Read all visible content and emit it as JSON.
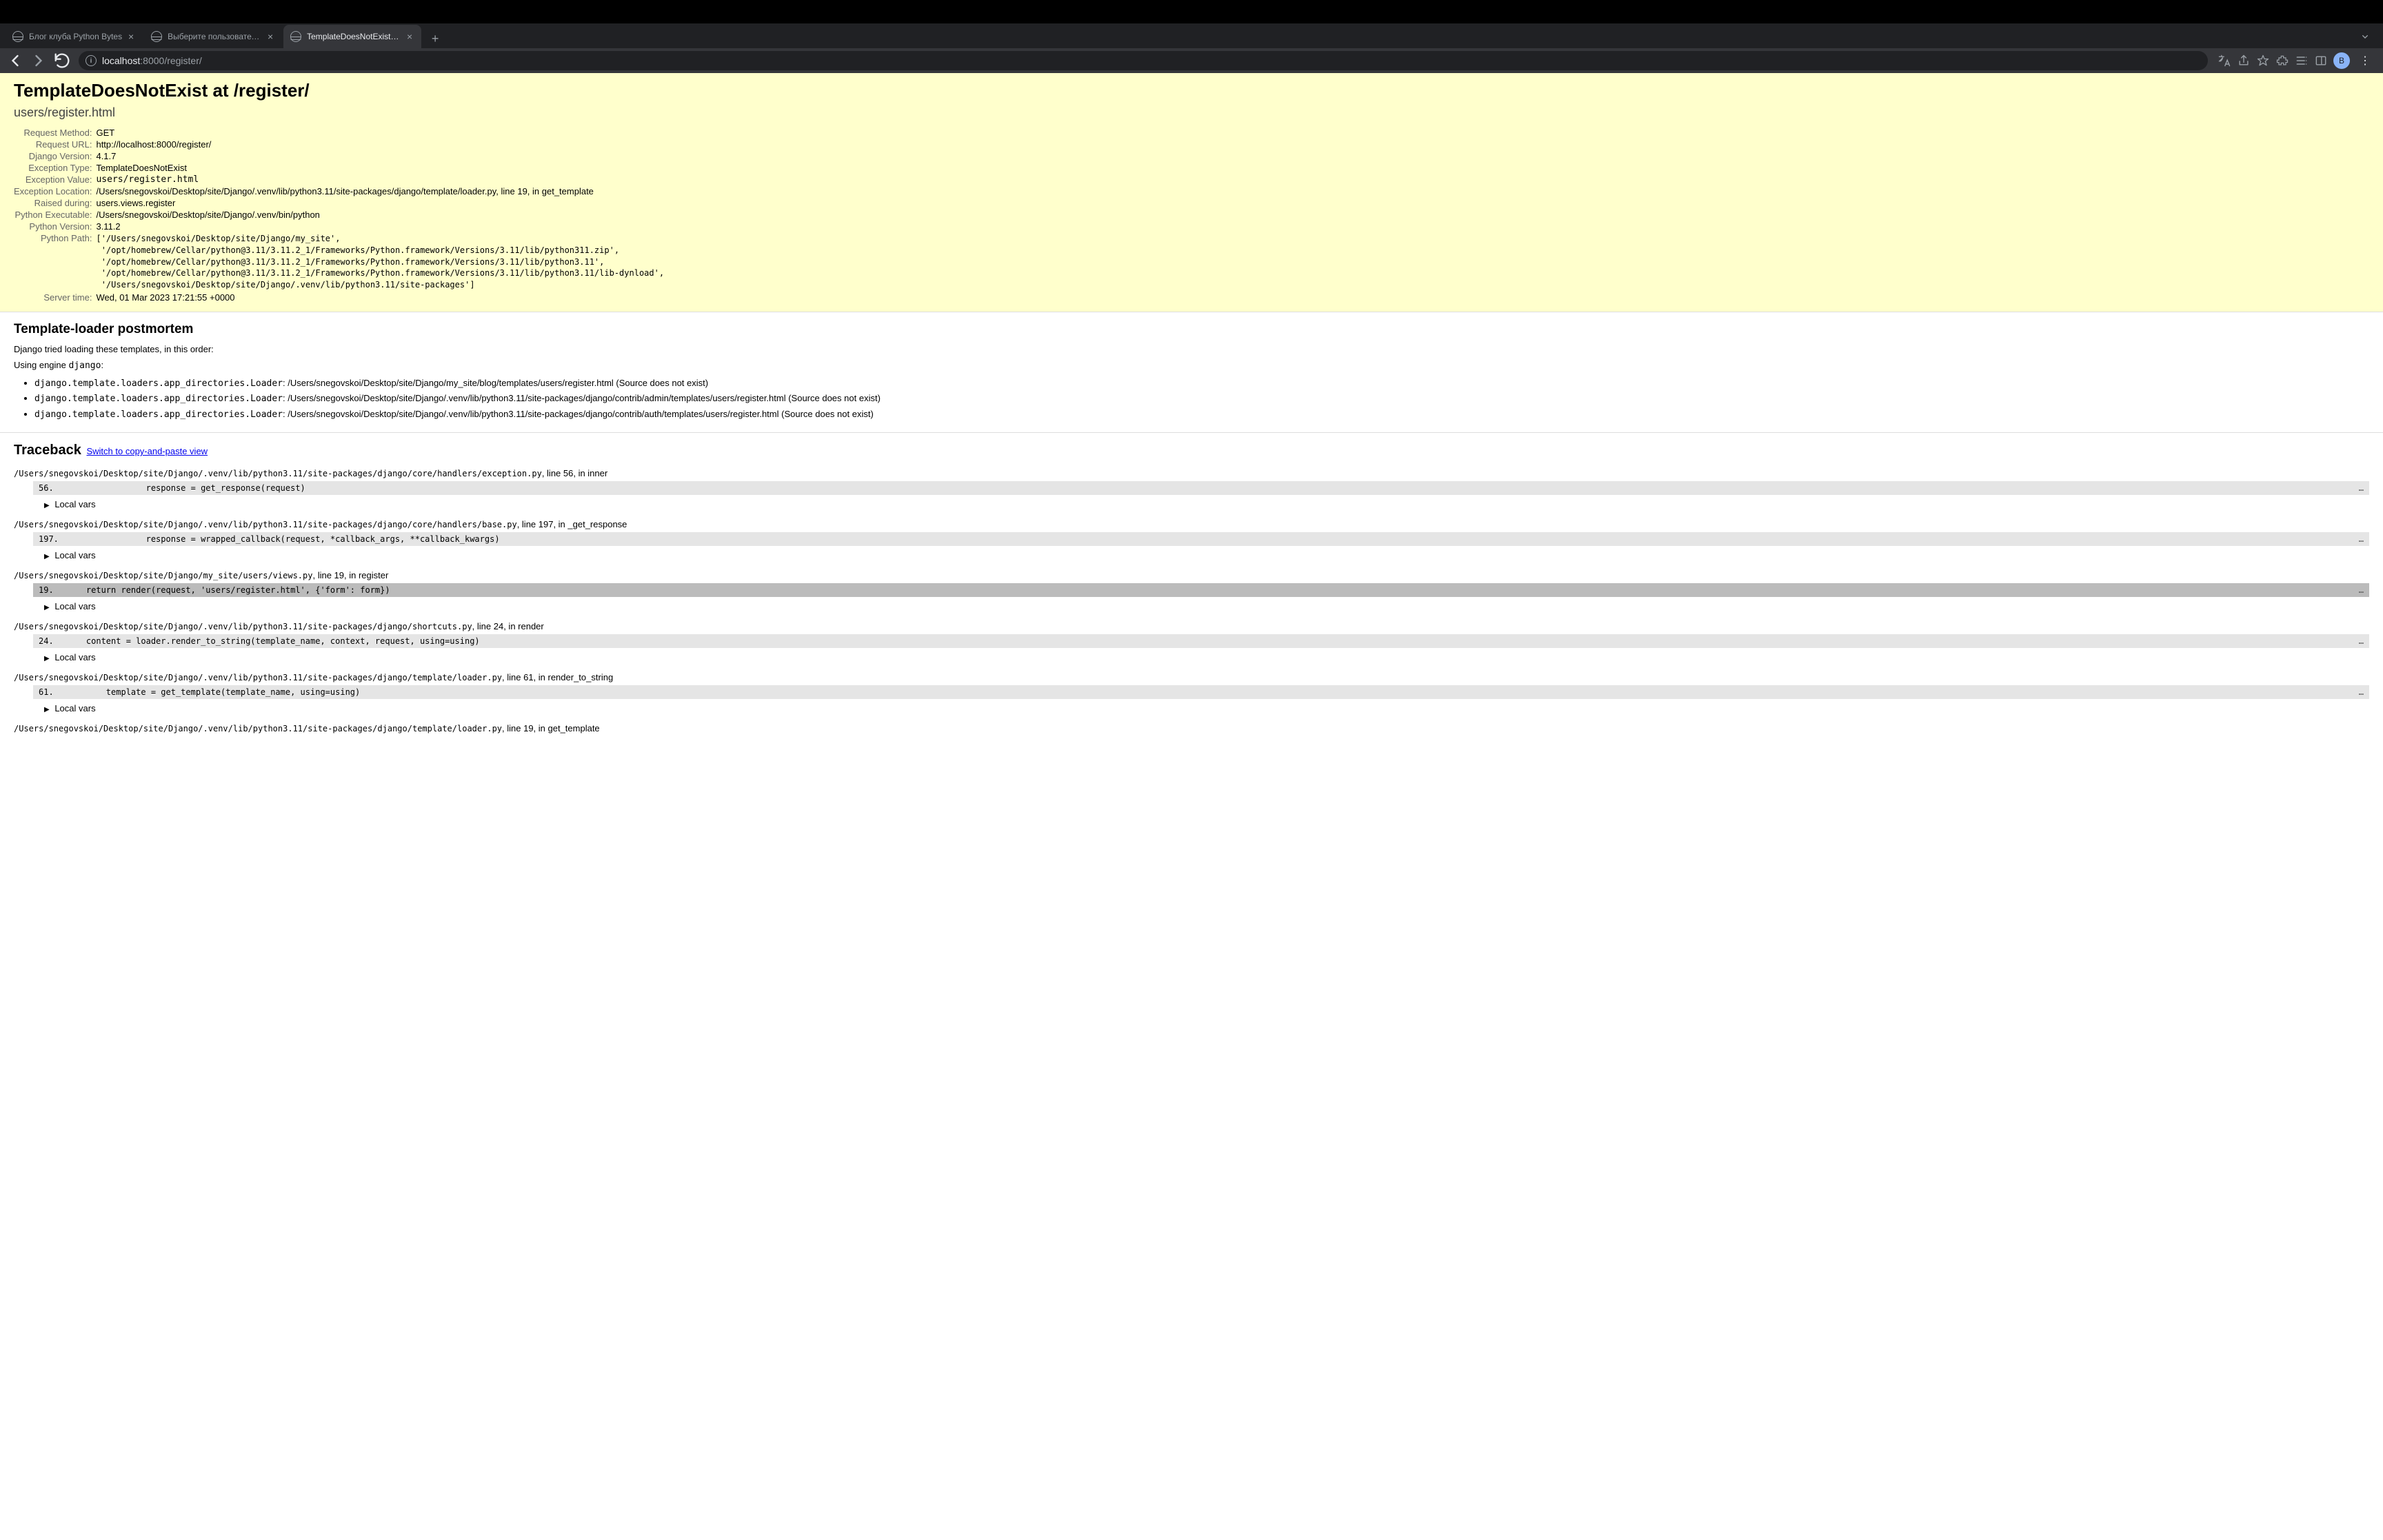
{
  "browser": {
    "tabs": [
      {
        "title": "Блог клуба Python Bytes",
        "active": false
      },
      {
        "title": "Выберите пользователь для и",
        "active": false
      },
      {
        "title": "TemplateDoesNotExist at /regis",
        "active": true
      }
    ],
    "url_host": "localhost",
    "url_port": ":8000",
    "url_path": "/register/",
    "profile_initial": "B"
  },
  "summary": {
    "title": "TemplateDoesNotExist at /register/",
    "subtitle": "users/register.html",
    "rows": {
      "request_method_label": "Request Method:",
      "request_method": "GET",
      "request_url_label": "Request URL:",
      "request_url": "http://localhost:8000/register/",
      "django_version_label": "Django Version:",
      "django_version": "4.1.7",
      "exception_type_label": "Exception Type:",
      "exception_type": "TemplateDoesNotExist",
      "exception_value_label": "Exception Value:",
      "exception_value": "users/register.html",
      "exception_location_label": "Exception Location:",
      "exception_location": "/Users/snegovskoi/Desktop/site/Django/.venv/lib/python3.11/site-packages/django/template/loader.py, line 19, in get_template",
      "raised_during_label": "Raised during:",
      "raised_during": "users.views.register",
      "python_executable_label": "Python Executable:",
      "python_executable": "/Users/snegovskoi/Desktop/site/Django/.venv/bin/python",
      "python_version_label": "Python Version:",
      "python_version": "3.11.2",
      "python_path_label": "Python Path:",
      "python_path": "['/Users/snegovskoi/Desktop/site/Django/my_site',\n '/opt/homebrew/Cellar/python@3.11/3.11.2_1/Frameworks/Python.framework/Versions/3.11/lib/python311.zip',\n '/opt/homebrew/Cellar/python@3.11/3.11.2_1/Frameworks/Python.framework/Versions/3.11/lib/python3.11',\n '/opt/homebrew/Cellar/python@3.11/3.11.2_1/Frameworks/Python.framework/Versions/3.11/lib/python3.11/lib-dynload',\n '/Users/snegovskoi/Desktop/site/Django/.venv/lib/python3.11/site-packages']",
      "server_time_label": "Server time:",
      "server_time": "Wed, 01 Mar 2023 17:21:55 +0000"
    }
  },
  "postmortem": {
    "heading": "Template-loader postmortem",
    "intro": "Django tried loading these templates, in this order:",
    "engine_prefix": "Using engine ",
    "engine_name": "django",
    "loader": "django.template.loaders.app_directories.Loader",
    "items": [
      {
        "path": "/Users/snegovskoi/Desktop/site/Django/my_site/blog/templates/users/register.html",
        "note": "(Source does not exist)"
      },
      {
        "path": "/Users/snegovskoi/Desktop/site/Django/.venv/lib/python3.11/site-packages/django/contrib/admin/templates/users/register.html",
        "note": "(Source does not exist)"
      },
      {
        "path": "/Users/snegovskoi/Desktop/site/Django/.venv/lib/python3.11/site-packages/django/contrib/auth/templates/users/register.html",
        "note": "(Source does not exist)"
      }
    ]
  },
  "traceback": {
    "heading": "Traceback",
    "switch_label": "Switch to copy-and-paste view",
    "local_vars_label": "Local vars",
    "frames": [
      {
        "file": "/Users/snegovskoi/Desktop/site/Django/.venv/lib/python3.11/site-packages/django/core/handlers/exception.py",
        "suffix": ", line 56, in inner",
        "lineno": "56.",
        "code": "                response = get_response(request)",
        "hl": false
      },
      {
        "file": "/Users/snegovskoi/Desktop/site/Django/.venv/lib/python3.11/site-packages/django/core/handlers/base.py",
        "suffix": ", line 197, in _get_response",
        "lineno": "197.",
        "code": "                response = wrapped_callback(request, *callback_args, **callback_kwargs)",
        "hl": false
      },
      {
        "file": "/Users/snegovskoi/Desktop/site/Django/my_site/users/views.py",
        "suffix": ", line 19, in register",
        "lineno": "19.",
        "code": "    return render(request, 'users/register.html', {'form': form})",
        "hl": true
      },
      {
        "file": "/Users/snegovskoi/Desktop/site/Django/.venv/lib/python3.11/site-packages/django/shortcuts.py",
        "suffix": ", line 24, in render",
        "lineno": "24.",
        "code": "    content = loader.render_to_string(template_name, context, request, using=using)",
        "hl": false
      },
      {
        "file": "/Users/snegovskoi/Desktop/site/Django/.venv/lib/python3.11/site-packages/django/template/loader.py",
        "suffix": ", line 61, in render_to_string",
        "lineno": "61.",
        "code": "        template = get_template(template_name, using=using)",
        "hl": false
      },
      {
        "file": "/Users/snegovskoi/Desktop/site/Django/.venv/lib/python3.11/site-packages/django/template/loader.py",
        "suffix": ", line 19, in get_template",
        "lineno": "",
        "code": "",
        "hl": false,
        "partial": true
      }
    ]
  }
}
